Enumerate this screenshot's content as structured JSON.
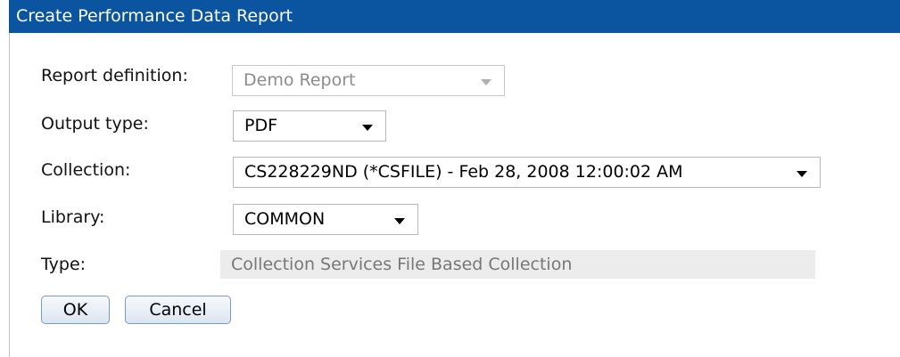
{
  "dialog": {
    "title": "Create Performance Data Report"
  },
  "form": {
    "report_definition": {
      "label": "Report definition:",
      "value": "Demo Report"
    },
    "output_type": {
      "label": "Output type:",
      "value": "PDF"
    },
    "collection": {
      "label": "Collection:",
      "value": "CS228229ND (*CSFILE) - Feb 28, 2008 12:00:02 AM"
    },
    "library": {
      "label": "Library:",
      "value": "COMMON"
    },
    "type": {
      "label": "Type:",
      "value": "Collection Services File Based Collection"
    }
  },
  "buttons": {
    "ok": "OK",
    "cancel": "Cancel"
  },
  "icons": {
    "dropdown": "chevron-down-icon"
  }
}
